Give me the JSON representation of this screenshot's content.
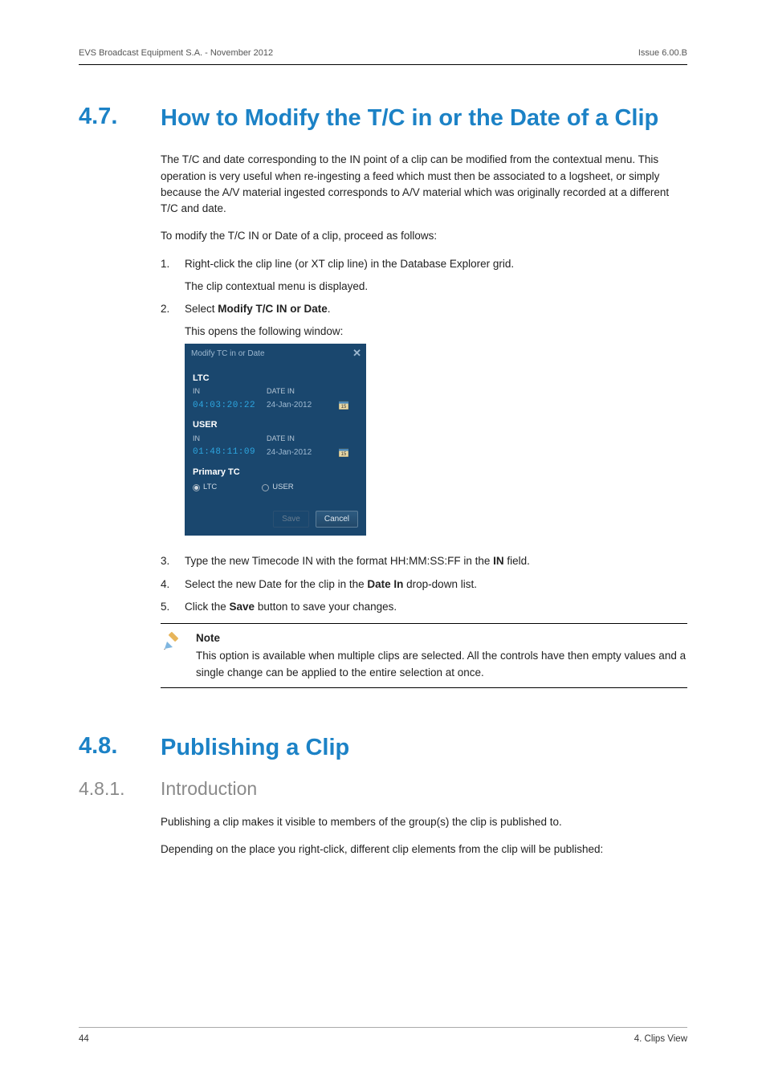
{
  "header": {
    "left": "EVS Broadcast Equipment S.A.  - November 2012",
    "right": "Issue 6.00.B"
  },
  "footer": {
    "left": "44",
    "right": "4. Clips View"
  },
  "sec47": {
    "num": "4.7.",
    "title": "How to Modify the T/C in or the Date of a Clip",
    "para1": "The T/C and date corresponding to the IN point of a clip can be modified from the contextual menu. This operation is very useful when re-ingesting a feed which must then be associated to a logsheet, or simply because the A/V material ingested corresponds to A/V material which was originally recorded at a different T/C and date.",
    "para2": "To modify the T/C IN or Date of a clip, proceed as follows:",
    "step1": "Right-click the clip line (or XT clip line) in the Database Explorer grid.",
    "step1_sub": "The clip contextual menu is displayed.",
    "step2_pre": "Select ",
    "step2_bold": "Modify T/C IN or Date",
    "step2_post": ".",
    "step2_sub": "This opens the following window:",
    "step3_pre": "Type the new Timecode IN with the format HH:MM:SS:FF in the ",
    "step3_bold": "IN",
    "step3_post": " field.",
    "step4_pre": "Select the new Date for the clip in the ",
    "step4_bold": "Date In",
    "step4_post": " drop-down list.",
    "step5_pre": "Click the ",
    "step5_bold": "Save",
    "step5_post": " button to save your changes.",
    "n1": "1.",
    "n2": "2.",
    "n3": "3.",
    "n4": "4.",
    "n5": "5."
  },
  "dialog": {
    "title": "Modify TC in or Date",
    "ltc_title": "LTC",
    "in_label": "IN",
    "date_in_label": "DATE IN",
    "ltc_tc": "04:03:20:22",
    "ltc_date": "24-Jan-2012",
    "user_title": "USER",
    "user_tc": "01:48:11:09",
    "user_date": "24-Jan-2012",
    "primary_title": "Primary TC",
    "radio_ltc": "LTC",
    "radio_user": "USER",
    "save_btn": "Save",
    "cancel_btn": "Cancel"
  },
  "note": {
    "title": "Note",
    "body": "This option is available when multiple clips are selected. All the controls have then empty values and a single change can be applied to the entire selection at once."
  },
  "sec48": {
    "num": "4.8.",
    "title": "Publishing a Clip"
  },
  "sec481": {
    "num": "4.8.1.",
    "title": "Introduction",
    "para1": "Publishing a clip makes it visible to members of the group(s) the clip is published to.",
    "para2": "Depending on the place you right-click, different clip elements from the clip will be published:"
  }
}
